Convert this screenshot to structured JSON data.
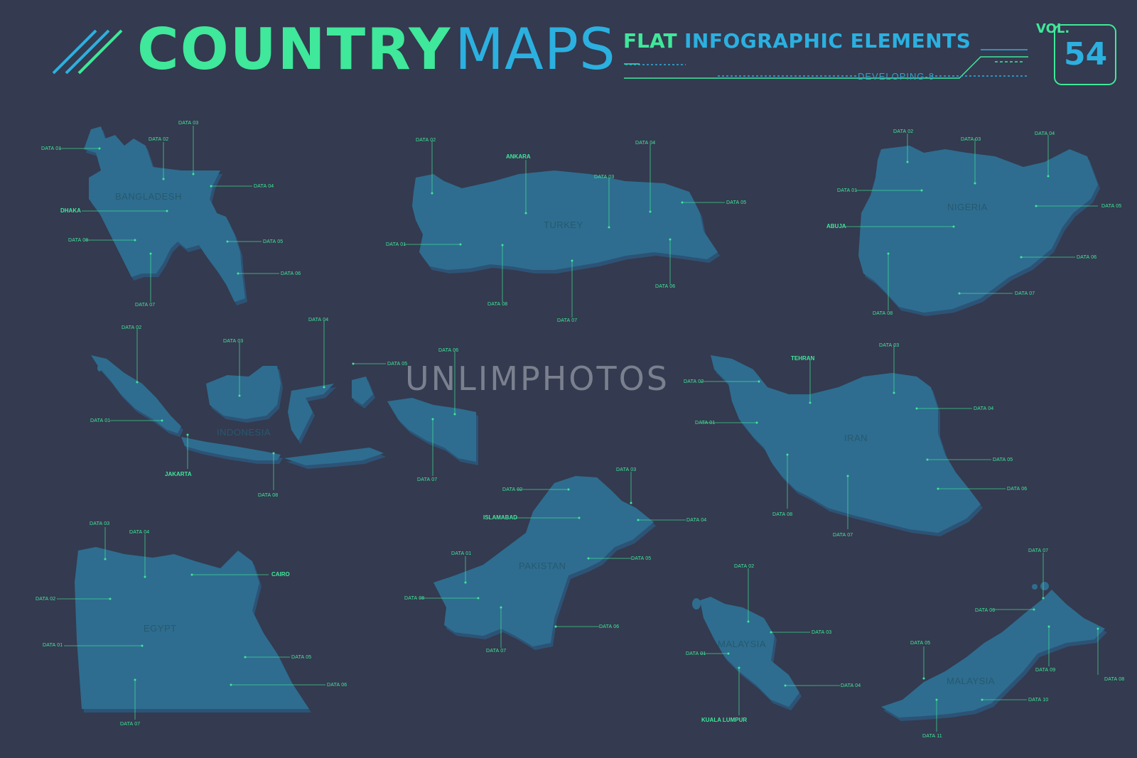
{
  "header": {
    "title_part1": "COUNTRY",
    "title_part2": "MAPS",
    "subtitle_part1": "FLAT",
    "subtitle_part2": "INFOGRAPHIC ELEMENTS",
    "series": "DEVELOPING-8",
    "vol_label": "VOL.",
    "vol_number": "54"
  },
  "watermark": "UNLIMPHOTOS",
  "colors": {
    "background": "#343a4f",
    "land": "#2f6d8f",
    "green_accent": "#3fe89a",
    "blue_accent": "#2bb0e0",
    "country_name": "#26596f"
  },
  "maps": {
    "bangladesh": {
      "name": "BANGLADESH",
      "capital": "DHAKA",
      "labels": [
        "DATA 01",
        "DATA 02",
        "DATA 03",
        "DATA 04",
        "DATA 05",
        "DATA 06",
        "DATA 07",
        "DATA 08"
      ]
    },
    "turkey": {
      "name": "TURKEY",
      "capital": "ANKARA",
      "labels": [
        "DATA 01",
        "DATA 02",
        "DATA 03",
        "DATA 04",
        "DATA 05",
        "DATA 06",
        "DATA 07",
        "DATA 08"
      ]
    },
    "nigeria": {
      "name": "NIGERIA",
      "capital": "ABUJA",
      "labels": [
        "DATA 01",
        "DATA 02",
        "DATA 03",
        "DATA 04",
        "DATA 05",
        "DATA 06",
        "DATA 07",
        "DATA 08"
      ]
    },
    "indonesia": {
      "name": "INDONESIA",
      "capital": "JAKARTA",
      "labels": [
        "DATA 01",
        "DATA 02",
        "DATA 03",
        "DATA 04",
        "DATA 05",
        "DATA 06",
        "DATA 07",
        "DATA 08"
      ]
    },
    "iran": {
      "name": "IRAN",
      "capital": "TEHRAN",
      "labels": [
        "DATA 01",
        "DATA 02",
        "DATA 03",
        "DATA 04",
        "DATA 05",
        "DATA 06",
        "DATA 07",
        "DATA 08"
      ]
    },
    "egypt": {
      "name": "EGYPT",
      "capital": "CAIRO",
      "labels": [
        "DATA 01",
        "DATA 02",
        "DATA 03",
        "DATA 04",
        "DATA 05",
        "DATA 06",
        "DATA 07"
      ]
    },
    "pakistan": {
      "name": "PAKISTAN",
      "capital": "ISLAMABAD",
      "labels": [
        "DATA 01",
        "DATA 02",
        "DATA 03",
        "DATA 04",
        "DATA 05",
        "DATA 06",
        "DATA 07",
        "DATA 08"
      ]
    },
    "malaysia_west": {
      "name": "MALAYSIA",
      "capital": "KUALA LUMPUR",
      "labels": [
        "DATA 01",
        "DATA 02",
        "DATA 03",
        "DATA 04"
      ]
    },
    "malaysia_east": {
      "name": "MALAYSIA",
      "labels": [
        "DATA 05",
        "DATA 06",
        "DATA 07",
        "DATA 08",
        "DATA 09",
        "DATA 10",
        "DATA 11"
      ]
    }
  }
}
